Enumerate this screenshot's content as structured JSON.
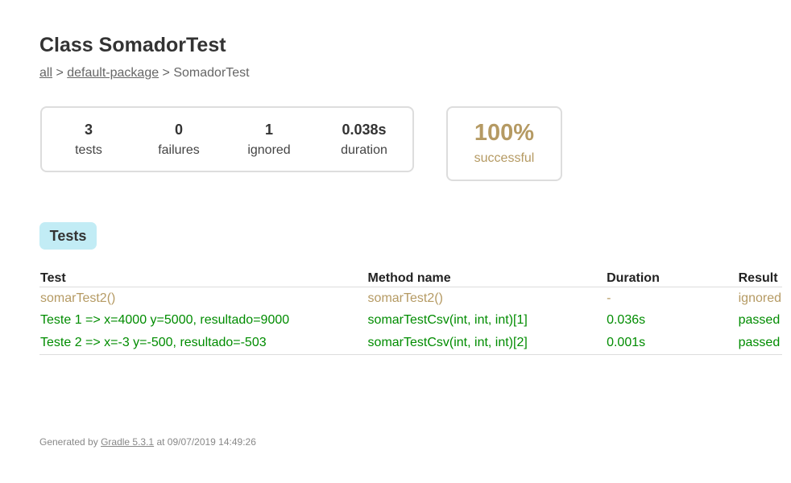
{
  "page": {
    "title": "Class SomadorTest"
  },
  "breadcrumbs": {
    "all": "all",
    "sep1": " > ",
    "package": "default-package",
    "sep2": " > ",
    "current": "SomadorTest"
  },
  "summary": {
    "tests": {
      "value": "3",
      "label": "tests"
    },
    "failures": {
      "value": "0",
      "label": "failures"
    },
    "ignored": {
      "value": "1",
      "label": "ignored"
    },
    "duration": {
      "value": "0.038s",
      "label": "duration"
    }
  },
  "success": {
    "percent": "100%",
    "label": "successful",
    "color": "#b59a63"
  },
  "tabs": {
    "tests": "Tests"
  },
  "table": {
    "headers": {
      "test": "Test",
      "method": "Method name",
      "duration": "Duration",
      "result": "Result"
    },
    "rows": [
      {
        "test": "somarTest2()",
        "method": "somarTest2()",
        "duration": "-",
        "result": "ignored"
      },
      {
        "test": "Teste 1 => x=4000 y=5000, resultado=9000",
        "method": "somarTestCsv(int, int, int)[1]",
        "duration": "0.036s",
        "result": "passed"
      },
      {
        "test": "Teste 2 => x=-3 y=-500, resultado=-503",
        "method": "somarTestCsv(int, int, int)[2]",
        "duration": "0.001s",
        "result": "passed"
      }
    ]
  },
  "colors": {
    "ignored": "#b59a63",
    "passed": "#008c00",
    "tab_background": "#c2ecf5"
  },
  "footer": {
    "prefix": "Generated by ",
    "link": "Gradle 5.3.1",
    "suffix": " at 09/07/2019 14:49:26"
  }
}
